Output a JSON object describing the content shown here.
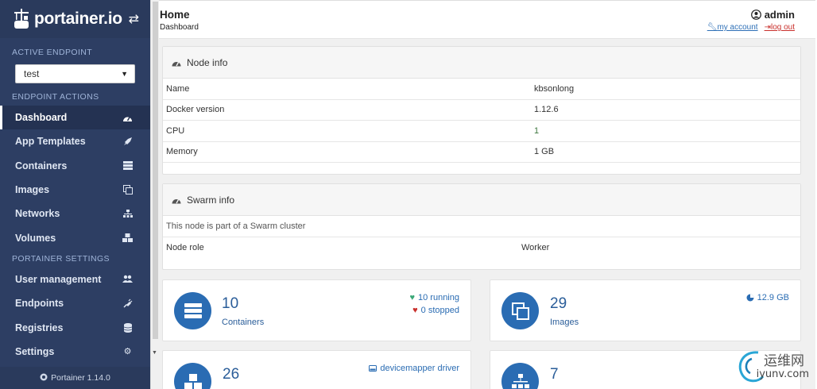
{
  "sidebar": {
    "logo_text": "portainer.io",
    "active_endpoint_heading": "ACTIVE ENDPOINT",
    "endpoint_selected": "test",
    "endpoint_actions_heading": "ENDPOINT ACTIONS",
    "items": [
      {
        "label": "Dashboard",
        "icon": "dashboard-icon"
      },
      {
        "label": "App Templates",
        "icon": "rocket-icon"
      },
      {
        "label": "Containers",
        "icon": "server-icon"
      },
      {
        "label": "Images",
        "icon": "clone-icon"
      },
      {
        "label": "Networks",
        "icon": "sitemap-icon"
      },
      {
        "label": "Volumes",
        "icon": "cubes-icon"
      }
    ],
    "settings_heading": "PORTAINER SETTINGS",
    "settings_items": [
      {
        "label": "User management",
        "icon": "users-icon"
      },
      {
        "label": "Endpoints",
        "icon": "plug-icon"
      },
      {
        "label": "Registries",
        "icon": "database-icon"
      },
      {
        "label": "Settings",
        "icon": "cogs-icon"
      }
    ],
    "footer": "Portainer 1.14.0"
  },
  "header": {
    "title": "Home",
    "breadcrumb": "Dashboard",
    "user": "admin",
    "my_account": "my account",
    "log_out": "log out"
  },
  "node_info": {
    "title": "Node info",
    "rows": [
      {
        "label": "Name",
        "value": "kbsonlong"
      },
      {
        "label": "Docker version",
        "value": "1.12.6"
      },
      {
        "label": "CPU",
        "value": "1"
      },
      {
        "label": "Memory",
        "value": "1 GB"
      }
    ]
  },
  "swarm_info": {
    "title": "Swarm info",
    "note": "This node is part of a Swarm cluster",
    "role_label": "Node role",
    "role_value": "Worker"
  },
  "cards": {
    "containers": {
      "count": "10",
      "label": "Containers",
      "running": "10 running",
      "stopped": "0 stopped"
    },
    "images": {
      "count": "29",
      "label": "Images",
      "size": "12.9 GB"
    },
    "volumes": {
      "count": "26",
      "driver": "devicemapper driver"
    },
    "networks": {
      "count": "7"
    }
  },
  "watermark": {
    "line1": "运维网",
    "line2": "iyunv.com"
  },
  "colors": {
    "sidebar": "#2d3e63",
    "accent": "#2a6cb3",
    "running": "#3aa877",
    "stopped": "#c9302c"
  }
}
